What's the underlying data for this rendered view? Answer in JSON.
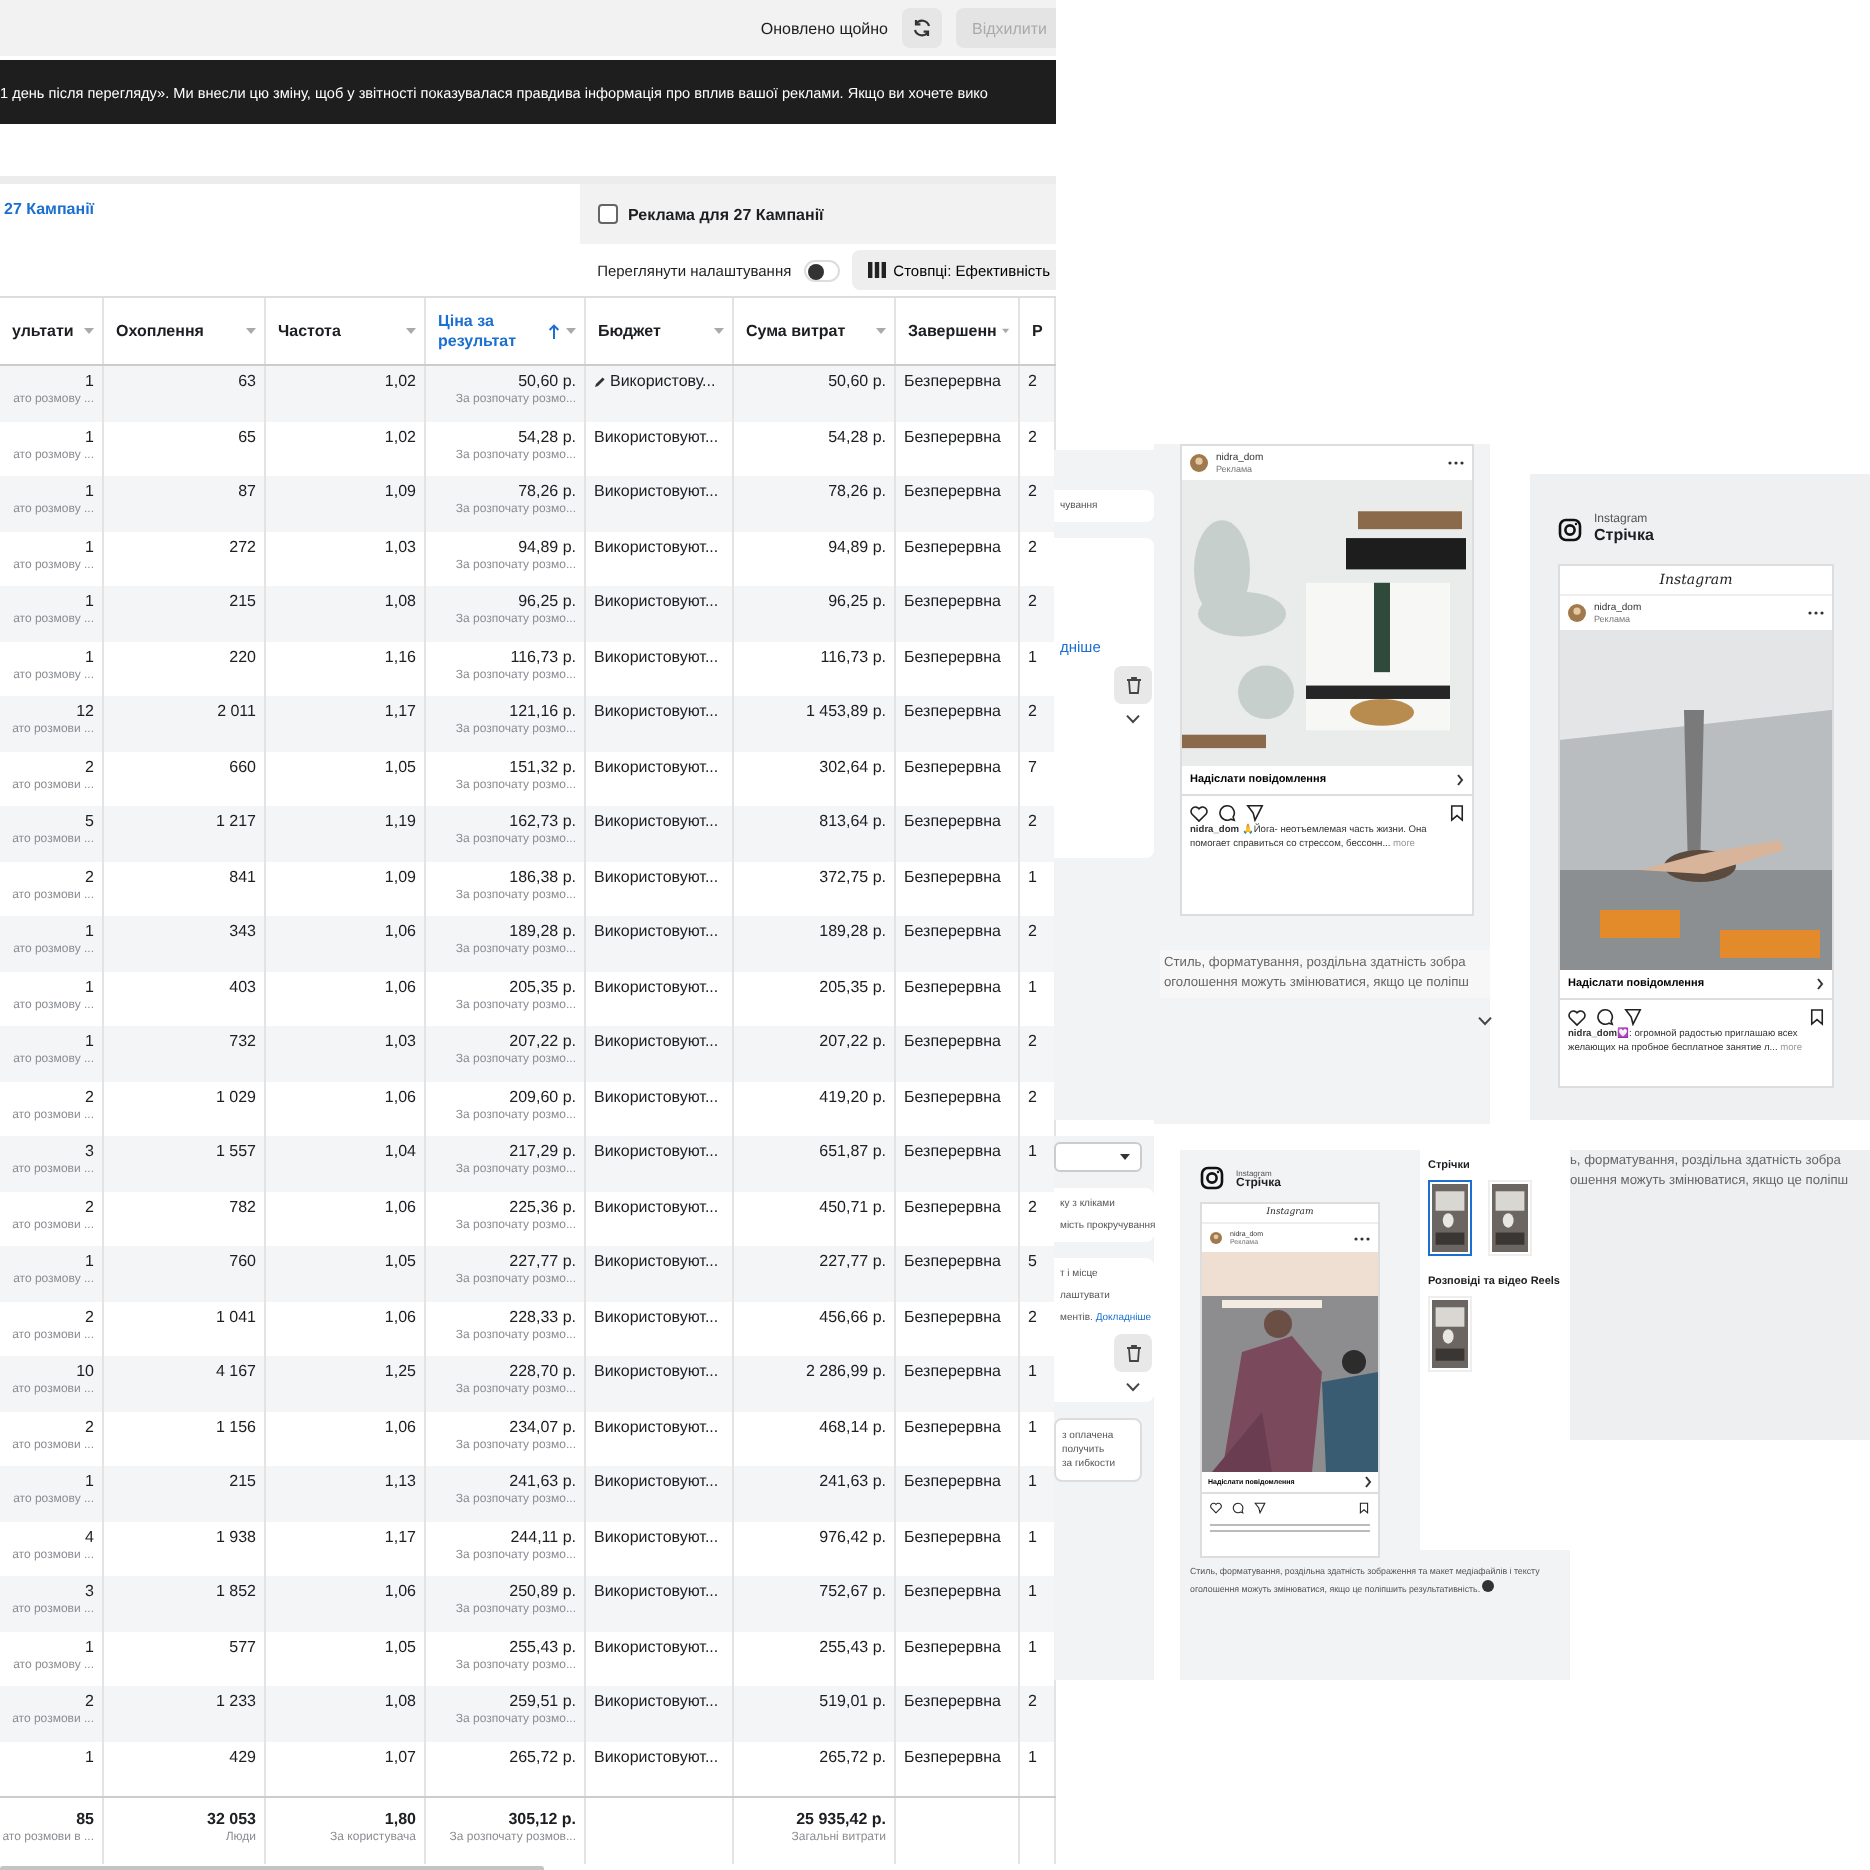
{
  "top_bar": {
    "status": "Оновлено щойно",
    "dismiss_button": {
      "label": "Відхилити",
      "disabled": true
    }
  },
  "banner": {
    "text": "1 день після перегляду». Ми внесли цю зміну, щоб у звітності показувалася правдива інформація про вплив вашої реклами. Якщо ви хочете вико"
  },
  "tabs": [
    {
      "label": "27 Кампанії",
      "selected": true
    },
    {
      "label": "Реклама для 27 Кампанії",
      "selected": false
    }
  ],
  "toolbar": {
    "settings_toggle": {
      "label": "Переглянути налаштування",
      "on": false
    },
    "columns_button": "Стовпці: Ефективність"
  },
  "table": {
    "columns": [
      {
        "label": "ультати",
        "sorted": false
      },
      {
        "label": "Охоплення",
        "sorted": false
      },
      {
        "label": "Частота",
        "sorted": false
      },
      {
        "label": "Ціна за результат",
        "sorted": true
      },
      {
        "label": "Бюджет",
        "sorted": false
      },
      {
        "label": "Сума витрат",
        "sorted": false
      },
      {
        "label": "Завершенн",
        "sorted": false
      },
      {
        "label": "Р",
        "sorted": false
      }
    ],
    "rows": [
      {
        "result": "1",
        "result_note": "ато розмову ...",
        "reach": "63",
        "frequency": "1,02",
        "cost": "50,60 р.",
        "cost_note": "За розпочату розмо...",
        "budget": "Використову...",
        "editable": true,
        "spent": "50,60 р.",
        "ending": "Безперервна",
        "col_9": "2"
      },
      {
        "result": "1",
        "result_note": "ато розмову ...",
        "reach": "65",
        "frequency": "1,02",
        "cost": "54,28 р.",
        "cost_note": "За розпочату розмо...",
        "budget": "Використовуют...",
        "editable": false,
        "spent": "54,28 р.",
        "ending": "Безперервна",
        "col_9": "2"
      },
      {
        "result": "1",
        "result_note": "ато розмову ...",
        "reach": "87",
        "frequency": "1,09",
        "cost": "78,26 р.",
        "cost_note": "За розпочату розмо...",
        "budget": "Використовуют...",
        "editable": false,
        "spent": "78,26 р.",
        "ending": "Безперервна",
        "col_9": "2"
      },
      {
        "result": "1",
        "result_note": "ато розмову ...",
        "reach": "272",
        "frequency": "1,03",
        "cost": "94,89 р.",
        "cost_note": "За розпочату розмо...",
        "budget": "Використовуют...",
        "editable": false,
        "spent": "94,89 р.",
        "ending": "Безперервна",
        "col_9": "2"
      },
      {
        "result": "1",
        "result_note": "ато розмову ...",
        "reach": "215",
        "frequency": "1,08",
        "cost": "96,25 р.",
        "cost_note": "За розпочату розмо...",
        "budget": "Використовуют...",
        "editable": false,
        "spent": "96,25 р.",
        "ending": "Безперервна",
        "col_9": "2"
      },
      {
        "result": "1",
        "result_note": "ато розмову ...",
        "reach": "220",
        "frequency": "1,16",
        "cost": "116,73 р.",
        "cost_note": "За розпочату розмо...",
        "budget": "Використовуют...",
        "editable": false,
        "spent": "116,73 р.",
        "ending": "Безперервна",
        "col_9": "1"
      },
      {
        "result": "12",
        "result_note": "ато розмови ...",
        "reach": "2 011",
        "frequency": "1,17",
        "cost": "121,16 р.",
        "cost_note": "За розпочату розмо...",
        "budget": "Використовуют...",
        "editable": false,
        "spent": "1 453,89 р.",
        "ending": "Безперервна",
        "col_9": "2"
      },
      {
        "result": "2",
        "result_note": "ато розмови ...",
        "reach": "660",
        "frequency": "1,05",
        "cost": "151,32 р.",
        "cost_note": "За розпочату розмо...",
        "budget": "Використовуют...",
        "editable": false,
        "spent": "302,64 р.",
        "ending": "Безперервна",
        "col_9": "7"
      },
      {
        "result": "5",
        "result_note": "ато розмови ...",
        "reach": "1 217",
        "frequency": "1,19",
        "cost": "162,73 р.",
        "cost_note": "За розпочату розмо...",
        "budget": "Використовуют...",
        "editable": false,
        "spent": "813,64 р.",
        "ending": "Безперервна",
        "col_9": "2"
      },
      {
        "result": "2",
        "result_note": "ато розмови ...",
        "reach": "841",
        "frequency": "1,09",
        "cost": "186,38 р.",
        "cost_note": "За розпочату розмо...",
        "budget": "Використовуют...",
        "editable": false,
        "spent": "372,75 р.",
        "ending": "Безперервна",
        "col_9": "1"
      },
      {
        "result": "1",
        "result_note": "ато розмову ...",
        "reach": "343",
        "frequency": "1,06",
        "cost": "189,28 р.",
        "cost_note": "За розпочату розмо...",
        "budget": "Використовуют...",
        "editable": false,
        "spent": "189,28 р.",
        "ending": "Безперервна",
        "col_9": "2"
      },
      {
        "result": "1",
        "result_note": "ато розмову ...",
        "reach": "403",
        "frequency": "1,06",
        "cost": "205,35 р.",
        "cost_note": "За розпочату розмо...",
        "budget": "Використовуют...",
        "editable": false,
        "spent": "205,35 р.",
        "ending": "Безперервна",
        "col_9": "1"
      },
      {
        "result": "1",
        "result_note": "ато розмову ...",
        "reach": "732",
        "frequency": "1,03",
        "cost": "207,22 р.",
        "cost_note": "За розпочату розмо...",
        "budget": "Використовуют...",
        "editable": false,
        "spent": "207,22 р.",
        "ending": "Безперервна",
        "col_9": "2"
      },
      {
        "result": "2",
        "result_note": "ато розмови ...",
        "reach": "1 029",
        "frequency": "1,06",
        "cost": "209,60 р.",
        "cost_note": "За розпочату розмо...",
        "budget": "Використовуют...",
        "editable": false,
        "spent": "419,20 р.",
        "ending": "Безперервна",
        "col_9": "2"
      },
      {
        "result": "3",
        "result_note": "ато розмови ...",
        "reach": "1 557",
        "frequency": "1,04",
        "cost": "217,29 р.",
        "cost_note": "За розпочату розмо...",
        "budget": "Використовуют...",
        "editable": false,
        "spent": "651,87 р.",
        "ending": "Безперервна",
        "col_9": "1"
      },
      {
        "result": "2",
        "result_note": "ато розмови ...",
        "reach": "782",
        "frequency": "1,06",
        "cost": "225,36 р.",
        "cost_note": "За розпочату розмо...",
        "budget": "Використовуют...",
        "editable": false,
        "spent": "450,71 р.",
        "ending": "Безперервна",
        "col_9": "2"
      },
      {
        "result": "1",
        "result_note": "ато розмову ...",
        "reach": "760",
        "frequency": "1,05",
        "cost": "227,77 р.",
        "cost_note": "За розпочату розмо...",
        "budget": "Використовуют...",
        "editable": false,
        "spent": "227,77 р.",
        "ending": "Безперервна",
        "col_9": "5"
      },
      {
        "result": "2",
        "result_note": "ато розмови ...",
        "reach": "1 041",
        "frequency": "1,06",
        "cost": "228,33 р.",
        "cost_note": "За розпочату розмо...",
        "budget": "Використовуют...",
        "editable": false,
        "spent": "456,66 р.",
        "ending": "Безперервна",
        "col_9": "2"
      },
      {
        "result": "10",
        "result_note": "ато розмови ...",
        "reach": "4 167",
        "frequency": "1,25",
        "cost": "228,70 р.",
        "cost_note": "За розпочату розмо...",
        "budget": "Використовуют...",
        "editable": false,
        "spent": "2 286,99 р.",
        "ending": "Безперервна",
        "col_9": "1"
      },
      {
        "result": "2",
        "result_note": "ато розмови ...",
        "reach": "1 156",
        "frequency": "1,06",
        "cost": "234,07 р.",
        "cost_note": "За розпочату розмо...",
        "budget": "Використовуют...",
        "editable": false,
        "spent": "468,14 р.",
        "ending": "Безперервна",
        "col_9": "1"
      },
      {
        "result": "1",
        "result_note": "ато розмову ...",
        "reach": "215",
        "frequency": "1,13",
        "cost": "241,63 р.",
        "cost_note": "За розпочату розмо...",
        "budget": "Використовуют...",
        "editable": false,
        "spent": "241,63 р.",
        "ending": "Безперервна",
        "col_9": "1"
      },
      {
        "result": "4",
        "result_note": "ато розмови ...",
        "reach": "1 938",
        "frequency": "1,17",
        "cost": "244,11 р.",
        "cost_note": "За розпочату розмо...",
        "budget": "Використовуют...",
        "editable": false,
        "spent": "976,42 р.",
        "ending": "Безперервна",
        "col_9": "1"
      },
      {
        "result": "3",
        "result_note": "ато розмови ...",
        "reach": "1 852",
        "frequency": "1,06",
        "cost": "250,89 р.",
        "cost_note": "За розпочату розмо...",
        "budget": "Використовуют...",
        "editable": false,
        "spent": "752,67 р.",
        "ending": "Безперервна",
        "col_9": "1"
      },
      {
        "result": "1",
        "result_note": "ато розмову ...",
        "reach": "577",
        "frequency": "1,05",
        "cost": "255,43 р.",
        "cost_note": "За розпочату розмо...",
        "budget": "Використовуют...",
        "editable": false,
        "spent": "255,43 р.",
        "ending": "Безперервна",
        "col_9": "1"
      },
      {
        "result": "2",
        "result_note": "ато розмови ...",
        "reach": "1 233",
        "frequency": "1,08",
        "cost": "259,51 р.",
        "cost_note": "За розпочату розмо...",
        "budget": "Використовуют...",
        "editable": false,
        "spent": "519,01 р.",
        "ending": "Безперервна",
        "col_9": "2"
      },
      {
        "result": "1",
        "reach": "429",
        "frequency": "1,07",
        "cost": "265,72 р.",
        "budget": "Використовуют...",
        "editable": false,
        "spent": "265,72 р.",
        "ending": "Безперервна",
        "col_9": "1"
      }
    ],
    "totals": {
      "result": {
        "value": "85",
        "note": "ато розмови в ..."
      },
      "reach": {
        "value": "32 053",
        "note": "Люди"
      },
      "frequency": {
        "value": "1,80",
        "note": "За користувача"
      },
      "cost": {
        "value": "305,12 р.",
        "note": "За розпочату розмов..."
      },
      "spent": {
        "value": "25 935,42 р.",
        "note": "Загальні витрати"
      }
    }
  },
  "left_strip": {
    "upper_text": "чування",
    "upper_link": "дніше",
    "lower_texts": [
      "ку з кліками",
      "мість прокручування",
      "т і місце",
      "лаштувати"
    ],
    "lower_trailing": "ментів.",
    "lower_link": "Докладніше",
    "box_lines": [
      "з оплачена",
      "получить",
      "за гибкости"
    ]
  },
  "feed_preview": {
    "account": "nidra_dom",
    "sponsored": "Реклама",
    "cta": "Надіслати повідомлення",
    "caption_user": "nidra_dom",
    "caption": "🙏Йога- неотъемлемая часть жизни. Она помогает справиться со стрессом, бессонн...",
    "more": "more",
    "notice_lines": [
      "Стиль, форматування, роздільна здатність зобра",
      "оголошення можуть змінюватися, якщо це поліпш"
    ]
  },
  "video_preview": {
    "platform": "Instagram",
    "placement": "Стрічка",
    "logo": "Instagram",
    "account": "nidra_dom",
    "sponsored": "Реклама",
    "cta": "Надіслати повідомлення",
    "caption_user": "nidra_dom",
    "caption": "💟: огромной радостью приглашаю всех желающих на пробное бесплатное занятие л...",
    "more": "more"
  },
  "placement_preview": {
    "platform": "Instagram",
    "placement": "Стрічка",
    "logo": "Instagram",
    "account": "nidra_dom",
    "sponsored": "Реклама",
    "cta": "Надіслати повідомлення",
    "groups": [
      {
        "title": "Стрічки",
        "thumbs": [
          {
            "selected": true
          },
          {
            "selected": false
          }
        ]
      },
      {
        "title": "Розповіді та відео Reels",
        "thumbs": [
          {
            "selected": false
          }
        ]
      }
    ],
    "notice": "Стиль, форматування, роздільна здатність зображення та макет медіафайлів і тексту оголошення можуть змінюватися, якщо це поліпшить результативність."
  },
  "notice_fragment": {
    "lines": [
      "ь, форматування, роздільна здатність зобра",
      "ошення можуть змінюватися, якщо це поліпш"
    ]
  }
}
